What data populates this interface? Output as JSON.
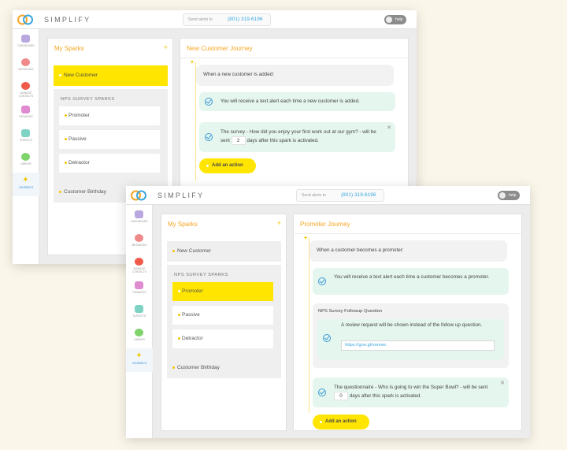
{
  "brand": "SIMPLIFY",
  "send_alerts_label": "Send alerts to",
  "phone": "(801) 319-6196",
  "help_label": "help",
  "nav_labels": [
    "Dashboard",
    "Messages",
    "Manage Contacts",
    "Rewards",
    "Surveys",
    "Library",
    "Journeys"
  ],
  "colors": {
    "accent_yellow": "#ffe500",
    "accent_orange": "#f5a623",
    "link_blue": "#3aa7de",
    "success_bg": "#e5f6ee"
  },
  "sparks": {
    "title": "My Sparks",
    "plus": "+",
    "new_customer": "New Customer",
    "nps_heading": "NPS SURVEY SPARKS",
    "promoter": "Promoter",
    "passive": "Passive",
    "detractor": "Detractor",
    "customer_birthday": "Customer Birthday"
  },
  "journey1": {
    "title": "New Customer Journey",
    "trigger": "When a new customer is added:",
    "action1": "You will receive a text alert each time a new customer is added.",
    "action2_pre": "The survey - How did you enjoy your first work out at our gym? - will be sent",
    "action2_days": "2",
    "action2_post": "days after this spark is activated.",
    "add_action": "Add an action"
  },
  "journey2": {
    "title": "Promoter Journey",
    "trigger": "When a customer becomes a promoter:",
    "action1": "You will receive a text alert each time a customer becomes a promoter.",
    "followup_title": "NPS Survey Followup Question",
    "followup_text": "A review request will be shown instead of the follow up question.",
    "followup_url": "https://goo.gl/snmwc",
    "action3_pre": "The questionnaire - Who is going to win the Super Bowl? - will be sent",
    "action3_days": "0",
    "action3_post": "days after this spark is activated.",
    "add_action": "Add an action"
  }
}
